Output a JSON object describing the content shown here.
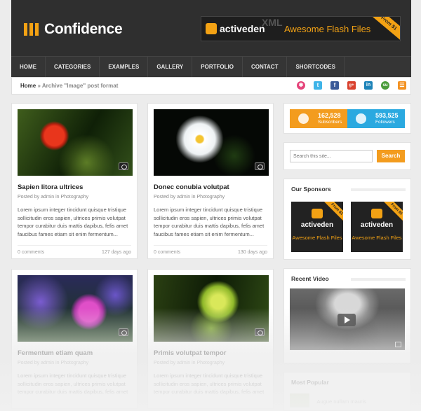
{
  "header": {
    "logo_text": "Confidence",
    "banner": {
      "logo": "activeden",
      "ghost": "XML",
      "text": "Awesome Flash Files",
      "ribbon": "From $1"
    }
  },
  "nav": {
    "items": [
      "HOME",
      "CATEGORIES",
      "EXAMPLES",
      "GALLERY",
      "PORTFOLIO",
      "CONTACT",
      "SHORTCODES"
    ]
  },
  "breadcrumb": {
    "home": "Home",
    "sep": "»",
    "current": "Archive \"Image\" post format"
  },
  "social": [
    {
      "icon": "dribbble-icon",
      "glyph": "✱",
      "color": "#e5447a"
    },
    {
      "icon": "twitter-icon",
      "glyph": "t",
      "color": "#3fb4e8"
    },
    {
      "icon": "facebook-icon",
      "glyph": "f",
      "color": "#3a5a98"
    },
    {
      "icon": "google-plus-icon",
      "glyph": "g+",
      "color": "#d9412e"
    },
    {
      "icon": "linkedin-icon",
      "glyph": "in",
      "color": "#1d83b8"
    },
    {
      "icon": "stumbleupon-icon",
      "glyph": "su",
      "color": "#4a9c3a"
    },
    {
      "icon": "rss-icon",
      "glyph": "☰",
      "color": "#f39222"
    }
  ],
  "posts": [
    {
      "title": "Sapien litora ultrices",
      "meta": "Posted by admin in Photography",
      "excerpt": "Lorem ipsum integer tincidunt quisque tristique sollicitudin eros sapien, ultrices primis volutpat tempor curabitur duis mattis dapibus, felis amet faucibus fames etiam sit enim fermentum...",
      "comments": "0 comments",
      "age": "127 days ago"
    },
    {
      "title": "Donec conubia volutpat",
      "meta": "Posted by admin in Photography",
      "excerpt": "Lorem ipsum integer tincidunt quisque tristique sollicitudin eros sapien, ultrices primis volutpat tempor curabitur duis mattis dapibus, felis amet faucibus fames etiam sit enim fermentum...",
      "comments": "0 comments",
      "age": "130 days ago"
    },
    {
      "title": "Fermentum etiam quam",
      "meta": "Posted by admin in Photography",
      "excerpt": "Lorem ipsum integer tincidunt quisque tristique sollicitudin eros sapien, ultrices primis volutpat tempor curabitur duis mattis dapibus, felis amet"
    },
    {
      "title": "Primis volutpat tempor",
      "meta": "Posted by admin in Photography",
      "excerpt": "Lorem ipsum integer tincidunt quisque tristique sollicitudin eros sapien, ultrices primis volutpat tempor curabitur duis mattis dapibus, felis amet"
    }
  ],
  "sidebar": {
    "rss": {
      "count": "162,528",
      "label": "Subscribers",
      "color": "#f39c1e"
    },
    "twitter": {
      "count": "593,525",
      "label": "Followers",
      "color": "#2aa9e0"
    },
    "search": {
      "placeholder": "Search this site...",
      "button": "Search"
    },
    "sponsors_title": "Our Sponsors",
    "sponsor": {
      "logo": "activeden",
      "text": "Awesome Flash Files",
      "ribbon": "From $1"
    },
    "video_title": "Recent Video",
    "popular_title": "Most Popular",
    "popular_item": "Augue nullam mauris"
  },
  "colors": {
    "accent": "#f3a214",
    "header_bg": "#2f2f2f"
  }
}
